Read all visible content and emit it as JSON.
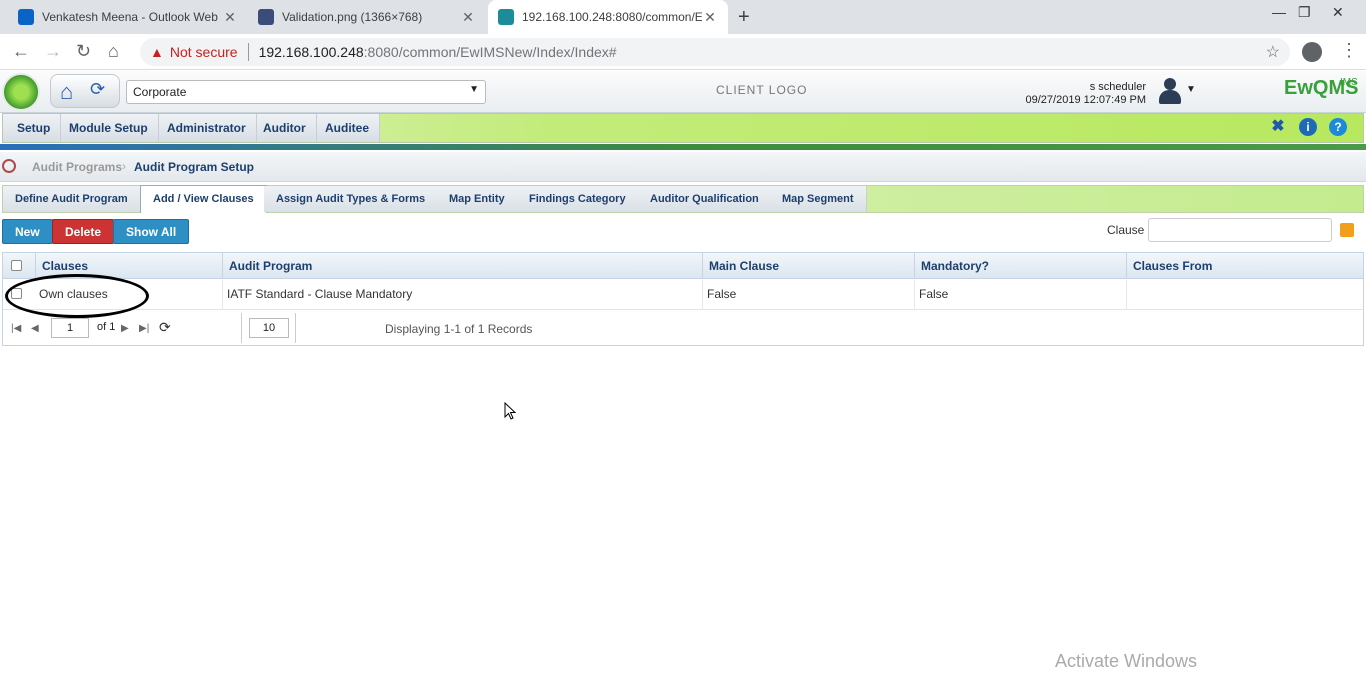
{
  "browser": {
    "tabs": [
      {
        "title": "Venkatesh Meena - Outlook Web"
      },
      {
        "title": "Validation.png (1366×768)"
      },
      {
        "title": "192.168.100.248:8080/common/E"
      }
    ],
    "security": "Not secure",
    "url_host": "192.168.100.248",
    "url_path": ":8080/common/EwIMSNew/Index/Index#"
  },
  "header": {
    "org": "Corporate",
    "client_logo": "CLIENT LOGO",
    "user": "s scheduler",
    "datetime": "09/27/2019 12:07:49 PM",
    "brand": "EwQMS",
    "brand_sub": "IMS"
  },
  "menu": [
    "Setup",
    "Module Setup",
    "Administrator",
    "Auditor",
    "Auditee"
  ],
  "breadcrumb": {
    "parent": "Audit Programs",
    "current": "Audit Program Setup"
  },
  "subtabs": [
    "Define Audit Program",
    "Add / View Clauses",
    "Assign Audit Types & Forms",
    "Map Entity",
    "Findings Category",
    "Auditor Qualification",
    "Map Segment"
  ],
  "toolbar": {
    "new": "New",
    "delete": "Delete",
    "show_all": "Show All",
    "filter_label": "Clause"
  },
  "grid": {
    "columns": [
      "Clauses",
      "Audit Program",
      "Main Clause",
      "Mandatory?",
      "Clauses From"
    ],
    "rows": [
      {
        "clauses": "Own clauses",
        "audit_program": "IATF Standard - Clause Mandatory",
        "main_clause": "False",
        "mandatory": "False",
        "clauses_from": ""
      }
    ],
    "page": "1",
    "of": "of 1",
    "page_size": "10",
    "display": "Displaying 1-1 of 1 Records"
  },
  "watermark": "Activate Windows"
}
